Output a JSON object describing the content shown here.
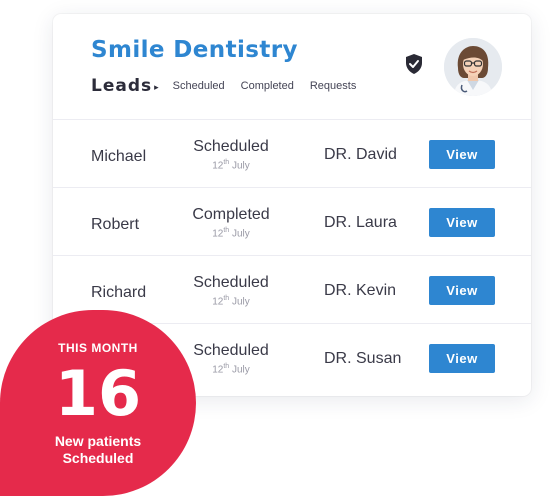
{
  "header": {
    "brand": "Smile Dentistry",
    "leads_label": "Leads",
    "caret": "▸",
    "tabs": [
      "Scheduled",
      "Completed",
      "Requests"
    ],
    "shield_icon": "shield-check-icon",
    "avatar": "doctor-avatar"
  },
  "rows": [
    {
      "name": "Michael",
      "status": "Scheduled",
      "date_num": "12",
      "date_suffix": "th",
      "date_month": "July",
      "doctor": "DR. David",
      "action": "View"
    },
    {
      "name": "Robert",
      "status": "Completed",
      "date_num": "12",
      "date_suffix": "th",
      "date_month": "July",
      "doctor": "DR. Laura",
      "action": "View"
    },
    {
      "name": "Richard",
      "status": "Scheduled",
      "date_num": "12",
      "date_suffix": "th",
      "date_month": "July",
      "doctor": "DR. Kevin",
      "action": "View"
    },
    {
      "name": "",
      "status": "Scheduled",
      "date_num": "12",
      "date_suffix": "th",
      "date_month": "July",
      "doctor": "DR. Susan",
      "action": "View"
    }
  ],
  "badge": {
    "label": "THIS MONTH",
    "count": "16",
    "line1": "New patients",
    "line2": "Scheduled"
  },
  "colors": {
    "accent": "#2e86d1",
    "badge": "#e52a4b"
  }
}
